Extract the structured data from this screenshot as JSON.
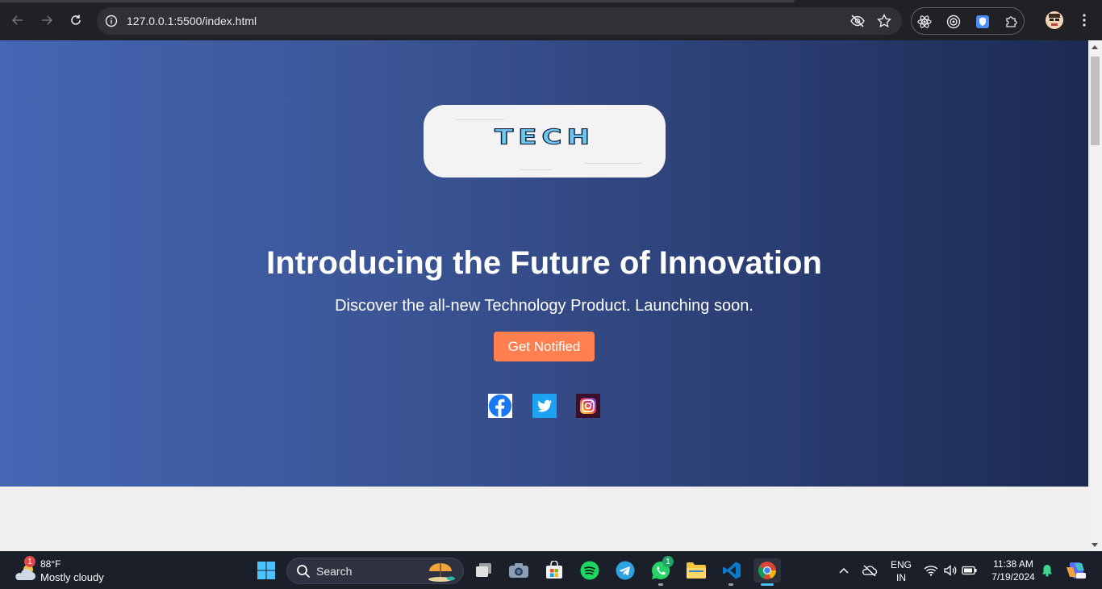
{
  "browser": {
    "url": "127.0.0.1:5500/index.html"
  },
  "page": {
    "logo_text": "TECH",
    "title": "Introducing the Future of Innovation",
    "subtitle": "Discover the all-new Technology Product. Launching soon.",
    "cta_label": "Get Notified",
    "social": [
      {
        "icon": "facebook-icon",
        "color": "#1877f2"
      },
      {
        "icon": "twitter-icon",
        "color": "#1da1f2"
      },
      {
        "icon": "instagram-icon",
        "color": "#c13584"
      }
    ],
    "hero_gradient": [
      "#4566b3",
      "#1c2a52"
    ],
    "cta_color": "#ff7f50"
  },
  "taskbar": {
    "weather_temp": "88°F",
    "weather_condition": "Mostly cloudy",
    "weather_badge": "1",
    "search_label": "Search",
    "whatsapp_badge": "1",
    "language_line1": "ENG",
    "language_line2": "IN",
    "time": "11:38 AM",
    "date": "7/19/2024"
  }
}
